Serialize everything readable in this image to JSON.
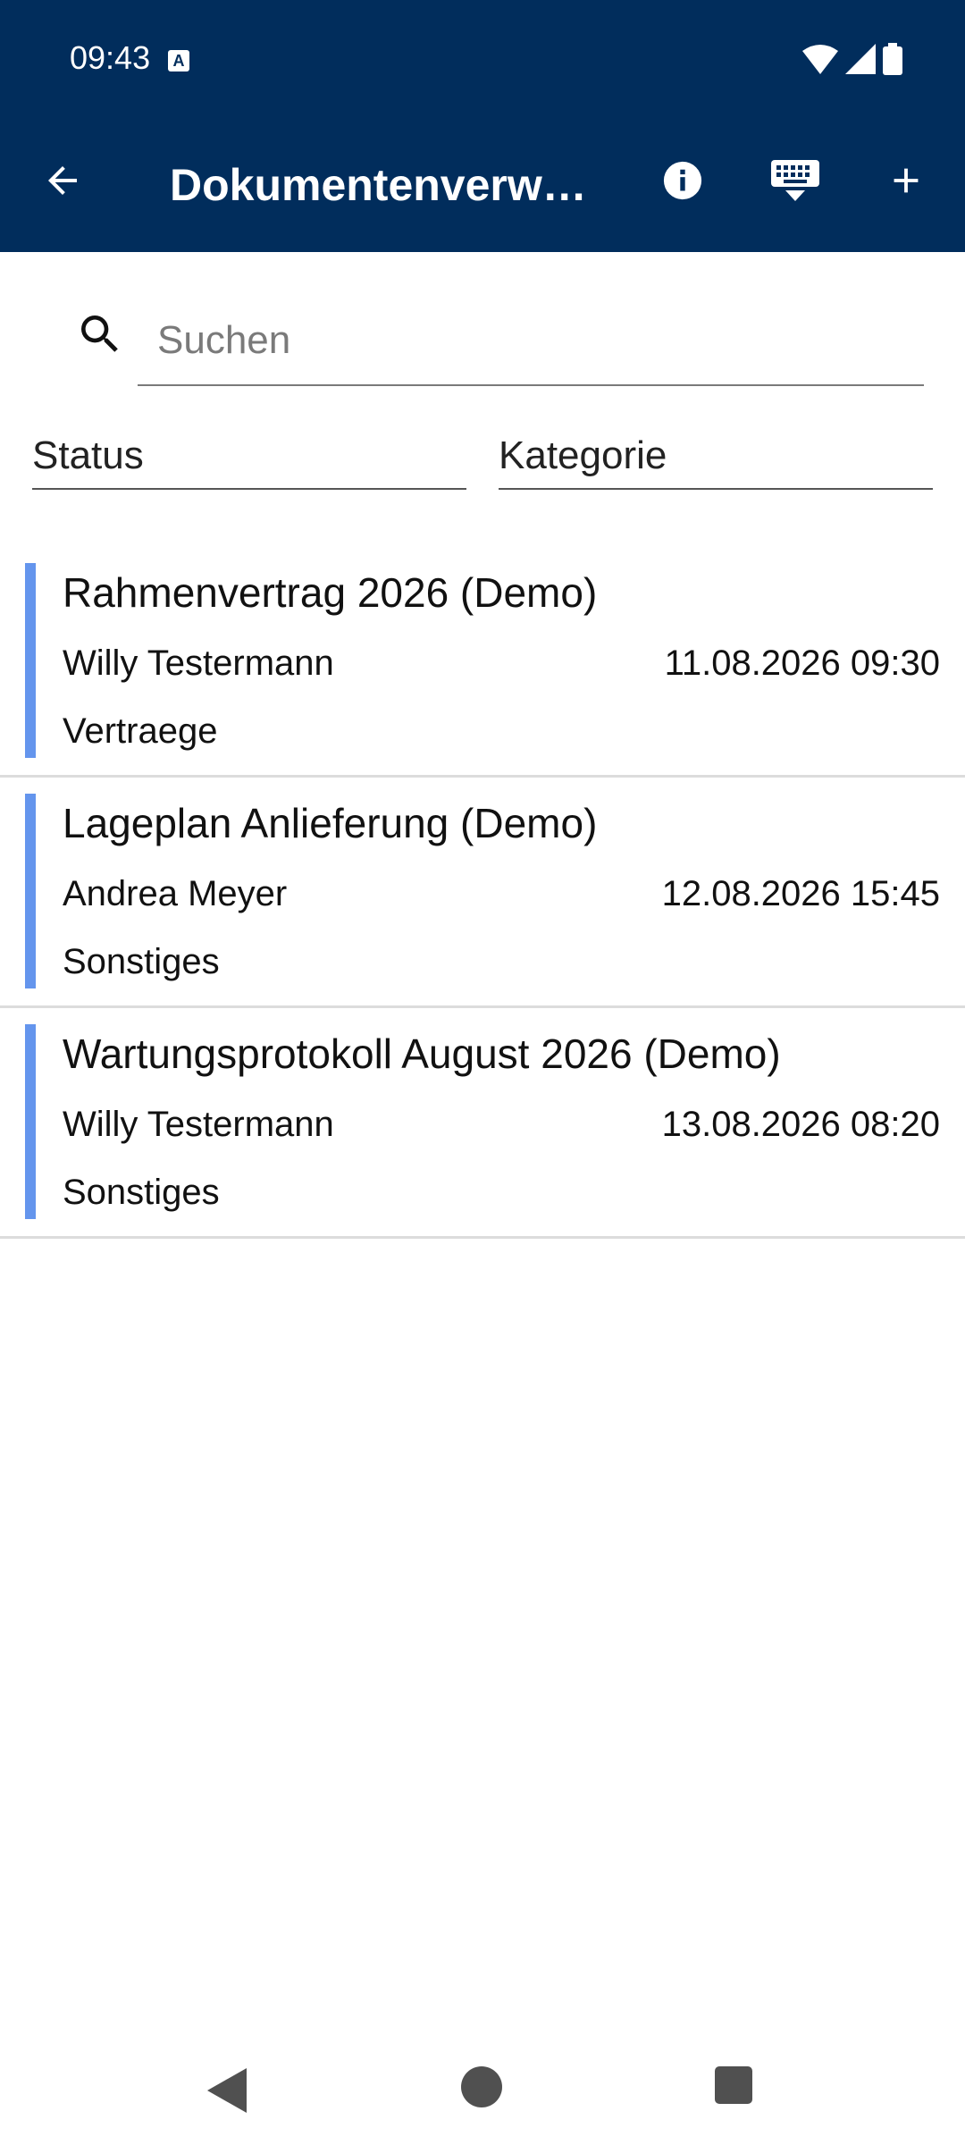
{
  "status_bar": {
    "time": "09:43",
    "a_icon_label": "A",
    "icons": [
      "wifi-icon",
      "signal-icon",
      "battery-icon"
    ]
  },
  "app_bar": {
    "title": "Dokumentenverwa…",
    "icons": [
      "back-arrow-icon",
      "info-icon",
      "keyboard-hide-icon",
      "add-icon"
    ]
  },
  "search": {
    "placeholder": "Suchen",
    "value": ""
  },
  "filters": {
    "status_label": "Status",
    "kategorie_label": "Kategorie"
  },
  "documents": [
    {
      "title": "Rahmenvertrag 2026 (Demo)",
      "author": "Willy Testermann",
      "datetime": "11.08.2026 09:30",
      "category": "Vertraege"
    },
    {
      "title": "Lageplan Anlieferung (Demo)",
      "author": "Andrea Meyer",
      "datetime": "12.08.2026 15:45",
      "category": "Sonstiges"
    },
    {
      "title": "Wartungsprotokoll August 2026 (Demo)",
      "author": "Willy Testermann",
      "datetime": "13.08.2026 08:20",
      "category": "Sonstiges"
    }
  ],
  "colors": {
    "app_bar_bg": "#012d5c",
    "accent_bar": "#6495ed",
    "divider": "#dcdcdc"
  }
}
